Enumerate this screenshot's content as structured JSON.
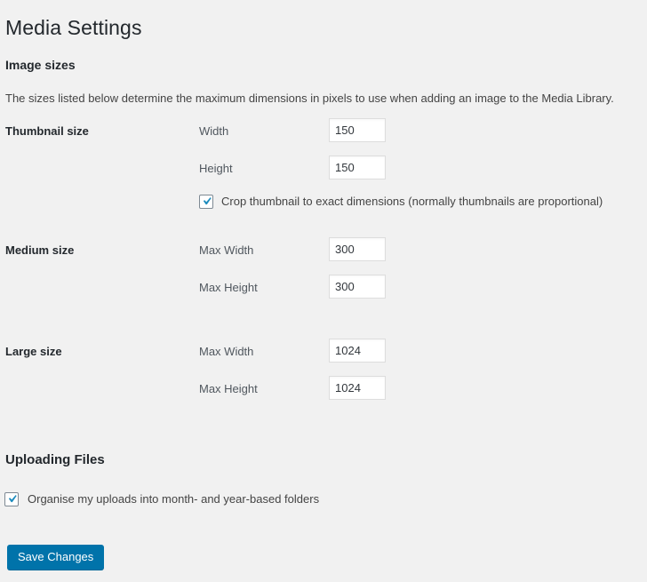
{
  "page": {
    "title": "Media Settings"
  },
  "image_sizes": {
    "heading": "Image sizes",
    "description": "The sizes listed below determine the maximum dimensions in pixels to use when adding an image to the Media Library.",
    "thumbnail": {
      "label": "Thumbnail size",
      "width_label": "Width",
      "width_value": "150",
      "height_label": "Height",
      "height_value": "150",
      "crop_label": "Crop thumbnail to exact dimensions (normally thumbnails are proportional)",
      "crop_checked": true
    },
    "medium": {
      "label": "Medium size",
      "width_label": "Max Width",
      "width_value": "300",
      "height_label": "Max Height",
      "height_value": "300"
    },
    "large": {
      "label": "Large size",
      "width_label": "Max Width",
      "width_value": "1024",
      "height_label": "Max Height",
      "height_value": "1024"
    }
  },
  "uploading_files": {
    "heading": "Uploading Files",
    "organise_label": "Organise my uploads into month- and year-based folders",
    "organise_checked": true
  },
  "actions": {
    "save_label": "Save Changes"
  },
  "colors": {
    "accent": "#0073aa",
    "page_background": "#f1f1f1",
    "heading_text": "#23282d",
    "body_text": "#444444",
    "input_border": "#dddddd",
    "checkbox_border": "#7e8993",
    "checkmark": "#1e8cbe"
  }
}
